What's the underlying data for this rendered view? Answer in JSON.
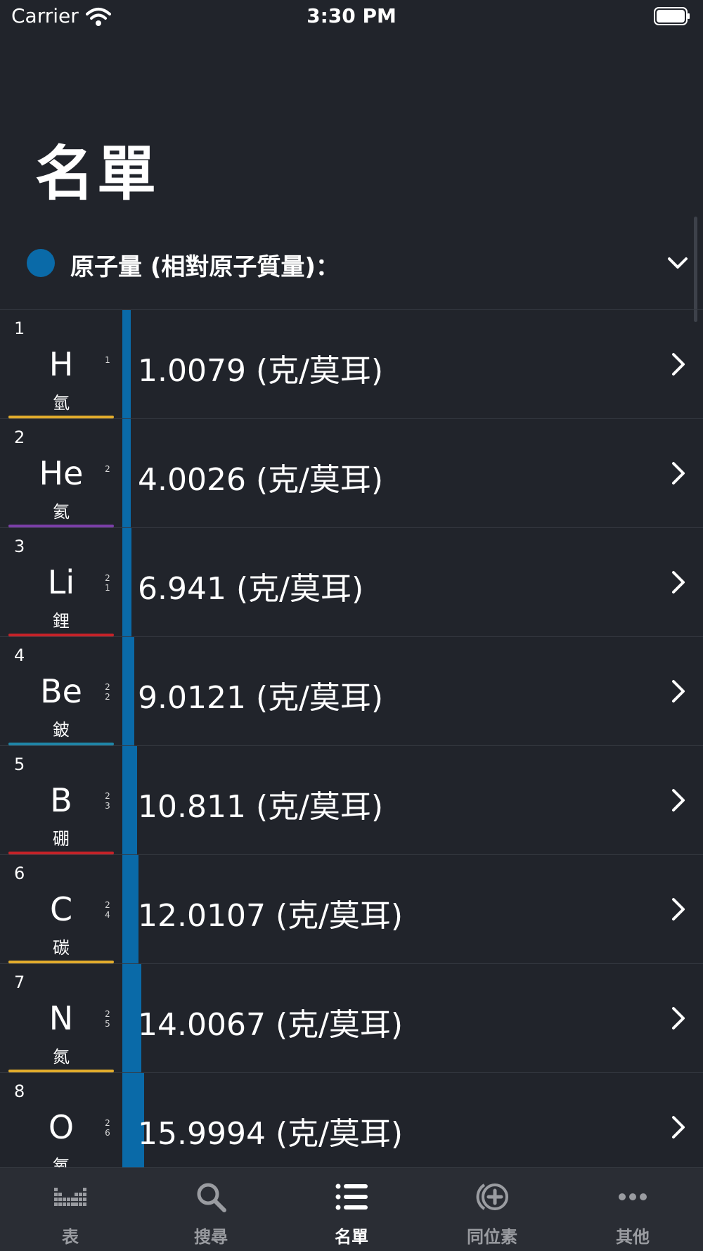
{
  "status_bar": {
    "carrier": "Carrier",
    "time": "3:30 PM"
  },
  "page_title": "名單",
  "property_selector": {
    "label": "原子量 (相對原子質量)：",
    "dot_color": "#0a6aa8"
  },
  "bar_color": "#0a6aa8",
  "elements": [
    {
      "number": "1",
      "symbol": "H",
      "name": "氫",
      "shells": [
        "1"
      ],
      "value": "1.0079 (克/莫耳)",
      "bar_fraction": 0.008,
      "group_color": "#e3ad2c"
    },
    {
      "number": "2",
      "symbol": "He",
      "name": "氦",
      "shells": [
        "2"
      ],
      "value": "4.0026 (克/莫耳)",
      "bar_fraction": 0.012,
      "group_color": "#7b3fa8"
    },
    {
      "number": "3",
      "symbol": "Li",
      "name": "鋰",
      "shells": [
        "2",
        "1"
      ],
      "value": "6.941 (克/莫耳)",
      "bar_fraction": 0.016,
      "group_color": "#c72228"
    },
    {
      "number": "4",
      "symbol": "Be",
      "name": "鈹",
      "shells": [
        "2",
        "2"
      ],
      "value": "9.0121 (克/莫耳)",
      "bar_fraction": 0.021,
      "group_color": "#1f86a8"
    },
    {
      "number": "5",
      "symbol": "B",
      "name": "硼",
      "shells": [
        "2",
        "3"
      ],
      "value": "10.811 (克/莫耳)",
      "bar_fraction": 0.026,
      "group_color": "#c72228"
    },
    {
      "number": "6",
      "symbol": "C",
      "name": "碳",
      "shells": [
        "2",
        "4"
      ],
      "value": "12.0107 (克/莫耳)",
      "bar_fraction": 0.029,
      "group_color": "#e3ad2c"
    },
    {
      "number": "7",
      "symbol": "N",
      "name": "氮",
      "shells": [
        "2",
        "5"
      ],
      "value": "14.0067 (克/莫耳)",
      "bar_fraction": 0.034,
      "group_color": "#e3ad2c"
    },
    {
      "number": "8",
      "symbol": "O",
      "name": "氧",
      "shells": [
        "2",
        "6"
      ],
      "value": "15.9994 (克/莫耳)",
      "bar_fraction": 0.039,
      "group_color": "#e3ad2c"
    }
  ],
  "tabs": [
    {
      "label": "表",
      "icon": "periodic-table-icon",
      "active": false
    },
    {
      "label": "搜尋",
      "icon": "search-icon",
      "active": false
    },
    {
      "label": "名單",
      "icon": "list-icon",
      "active": true
    },
    {
      "label": "同位素",
      "icon": "isotope-icon",
      "active": false
    },
    {
      "label": "其他",
      "icon": "more-icon",
      "active": false
    }
  ]
}
